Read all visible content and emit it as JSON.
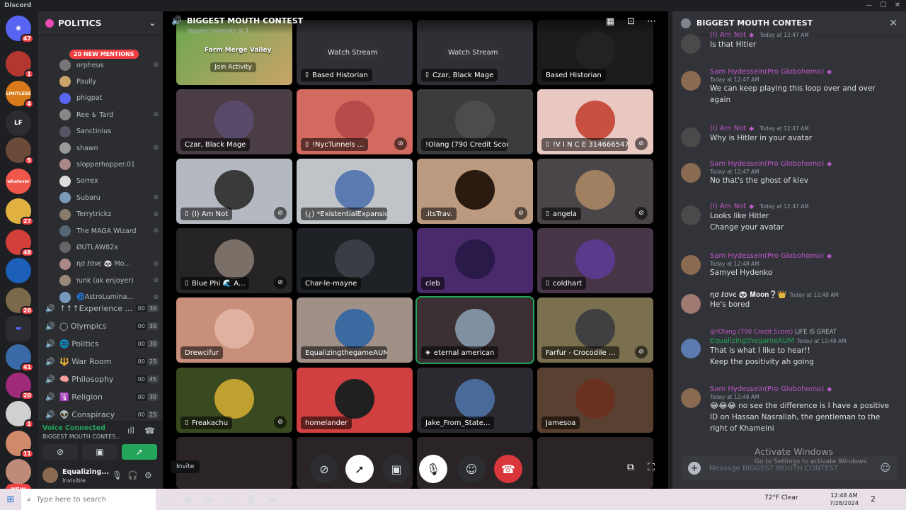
{
  "window": {
    "title": "Discord"
  },
  "servers": [
    {
      "label": "",
      "badge": "47",
      "color": "#5865f2",
      "icon": "discord-home-icon"
    },
    {
      "label": "",
      "badge": "1",
      "color": "#b3372f",
      "icon": "server-avatar-icon"
    },
    {
      "label": "LIMITLESS",
      "badge": "4",
      "color": "#d97a1a",
      "icon": "server-avatar-icon"
    },
    {
      "label": "LF",
      "badge": "",
      "color": "#2b2d31",
      "icon": "server-avatar-icon"
    },
    {
      "label": "",
      "badge": "5",
      "color": "#6b4a3a",
      "icon": "server-avatar-icon"
    },
    {
      "label": "whatever",
      "badge": "",
      "color": "#f0574b",
      "icon": "server-avatar-icon"
    },
    {
      "label": "",
      "badge": "27",
      "color": "#e0b040",
      "icon": "server-avatar-icon"
    },
    {
      "label": "",
      "badge": "48",
      "color": "#d43f3a",
      "icon": "server-avatar-icon"
    },
    {
      "label": "",
      "badge": "",
      "color": "#1b5fb8",
      "icon": "server-avatar-icon"
    },
    {
      "label": "",
      "badge": "26",
      "color": "#7a6a4a",
      "icon": "server-avatar-icon"
    },
    {
      "label": "",
      "badge": "",
      "color": "#5865f2",
      "icon": "folder-icon"
    },
    {
      "label": "",
      "badge": "41",
      "color": "#3a6aa8",
      "icon": "server-avatar-icon"
    },
    {
      "label": "",
      "badge": "20",
      "color": "#a02a7a",
      "icon": "server-avatar-icon"
    },
    {
      "label": "",
      "badge": "1",
      "color": "#d0d0d0",
      "icon": "server-avatar-icon"
    },
    {
      "label": "",
      "badge": "11",
      "color": "#d08a6a",
      "icon": "server-avatar-icon"
    },
    {
      "label": "",
      "badge": "",
      "color": "#c08a7a",
      "icon": "server-avatar-icon"
    }
  ],
  "new_label": "NEW",
  "sidebar": {
    "guild_name": "POLITICS",
    "mentions_label": "20 NEW MENTIONS",
    "members": [
      {
        "name": "orpheus",
        "color": "#777"
      },
      {
        "name": "Paully",
        "color": "#c9a36a"
      },
      {
        "name": "phigpat",
        "color": "#5865f2"
      },
      {
        "name": "Ree ♿ Tard",
        "color": "#888"
      },
      {
        "name": "Sanctinius",
        "color": "#556"
      },
      {
        "name": "shawn",
        "color": "#999"
      },
      {
        "name": "slopperhopper.01",
        "color": "#a88"
      },
      {
        "name": "Sorrex",
        "color": "#ddd"
      },
      {
        "name": "Subaru",
        "color": "#7a9ab8"
      },
      {
        "name": "Terrytrickz",
        "color": "#8a7a6a"
      },
      {
        "name": "The MAGA Wizard",
        "color": "#556677"
      },
      {
        "name": "ØUTLAW82x",
        "color": "#666"
      },
      {
        "name": "ɳσ ℓσνє 🐼 Mo...",
        "color": "#a88"
      },
      {
        "name": "𝔣unk (ak enjoyer)",
        "color": "#998877"
      },
      {
        "name": "🌀AstroLumina...",
        "color": "#7799bb"
      }
    ],
    "voice_channels": [
      {
        "name": "↑↑↑Experience ...",
        "a": "00",
        "b": "30",
        "icon": "🔊"
      },
      {
        "name": "◯ Olympics",
        "a": "00",
        "b": "30",
        "icon": "🔊"
      },
      {
        "name": "🌐 Politics",
        "a": "00",
        "b": "30",
        "icon": "🔊"
      },
      {
        "name": "🔱 War Room",
        "a": "00",
        "b": "25",
        "icon": "🔊"
      },
      {
        "name": "🧠 Philosophy",
        "a": "00",
        "b": "45",
        "icon": "🔊"
      },
      {
        "name": "🛐 Religion",
        "a": "00",
        "b": "30",
        "icon": "🔊"
      },
      {
        "name": "👽 Conspiracy",
        "a": "00",
        "b": "25",
        "icon": "🔊"
      }
    ],
    "voice_status": "Voice Connected",
    "voice_channel": "BIGGEST MOUTH CONTES...",
    "user_name": "Equalizing...",
    "user_status": "Invisible"
  },
  "stage": {
    "title": "BIGGEST MOUTH CONTEST",
    "subtitle": "Yappers University 😕 3",
    "activity": {
      "name": "Farm Merge Valley",
      "join": "Join Activity"
    },
    "watch_label": "Watch Stream",
    "tiles": [
      {
        "name": "Based Historian",
        "phone": true,
        "bg": "#2f3035",
        "watch": true
      },
      {
        "name": "Czar, Black Mage",
        "phone": true,
        "bg": "#2f3035",
        "watch": true
      },
      {
        "name": "Based Historian",
        "phone": false,
        "bg": "#1c1c1e",
        "pic": "#222"
      },
      {
        "name": "Czar, Black Mage",
        "phone": false,
        "bg": "#4a3d45",
        "pic": "#5a4a6a"
      },
      {
        "name": "!NycTunnels ...",
        "phone": true,
        "bg": "#d26a60",
        "pic": "#b84a4a",
        "mute": true
      },
      {
        "name": "!Olang (790 Credit Score)",
        "phone": false,
        "bg": "#3a3d3c",
        "pic": "#4a4d4c"
      },
      {
        "name": "!V I N C E 3146665477",
        "phone": true,
        "bg": "#e8c8c0",
        "pic": "#c85040",
        "mute": true
      },
      {
        "name": "(I) Am Not",
        "phone": true,
        "bg": "#b4b8c0",
        "pic": "#3a3a3a",
        "mute": true
      },
      {
        "name": "(¿) *ExistentialExpansio...",
        "phone": false,
        "bg": "#c0c4c8",
        "pic": "#5a7ab0"
      },
      {
        "name": ".itsTrav.",
        "phone": false,
        "bg": "#bc9a80",
        "pic": "#2a1a10",
        "mute": true
      },
      {
        "name": "angela",
        "phone": true,
        "bg": "#4a4548",
        "pic": "#a08060",
        "mute": true
      },
      {
        "name": "Blue Phi 🌊 A...",
        "phone": true,
        "bg": "#262424",
        "pic": "#7a7068",
        "mute": true
      },
      {
        "name": "Char-le-mayne",
        "phone": false,
        "bg": "#1e2226",
        "pic": "#3a3e44"
      },
      {
        "name": "cleb",
        "phone": false,
        "bg": "#4a2a6a",
        "pic": "#2a1a4a"
      },
      {
        "name": "coldhart",
        "phone": true,
        "bg": "#463648",
        "pic": "#5a3a8a"
      },
      {
        "name": "Drewcifur",
        "phone": false,
        "bg": "#c8907a",
        "pic": "#e0b0a0"
      },
      {
        "name": "EqualizingthegameAUM",
        "phone": false,
        "bg": "#a09088",
        "pic": "#3a6aa0"
      },
      {
        "name": "eternal american",
        "phone": false,
        "bg": "#3a3034",
        "pic": "#8090a0",
        "speaking": true,
        "ps": true
      },
      {
        "name": "Farfur - Crocodile ...",
        "phone": false,
        "bg": "#7a7050",
        "pic": "#404040",
        "mute": true
      },
      {
        "name": "Freakachu",
        "phone": true,
        "bg": "#3a4a20",
        "pic": "#c0a030",
        "mute": true
      },
      {
        "name": "homelander",
        "phone": false,
        "bg": "#d04040",
        "pic": "#202020"
      },
      {
        "name": "Jake_From_State...",
        "phone": false,
        "bg": "#2a2a30",
        "pic": "#4a6a9a"
      },
      {
        "name": "Jamesoa",
        "phone": false,
        "bg": "#5a4030",
        "pic": "#6a3020"
      }
    ]
  },
  "tooltip": {
    "invite": "Invite"
  },
  "chat": {
    "title": "BIGGEST MOUTH CONTEST",
    "placeholder": "Message BIGGEST MOUTH CONTEST",
    "messages": [
      {
        "author": "(I) Am Not",
        "gem": true,
        "time": "Today at 12:47 AM",
        "lines": [
          "Is that Hitler"
        ],
        "avc": "#4a4a4a",
        "inline": true
      },
      {
        "author": "Sam Hydessein(Pro Globohomo)",
        "gem": true,
        "time": "Today at 12:47 AM",
        "lines": [
          "We can keep playing this loop over and over again"
        ],
        "avc": "#8a6a50"
      },
      {
        "author": "(I) Am Not",
        "gem": true,
        "time": "Today at 12:47 AM",
        "lines": [
          "Why is Hitler in your avatar"
        ],
        "avc": "#4a4a4a",
        "inline": true
      },
      {
        "author": "Sam Hydessein(Pro Globohomo)",
        "gem": true,
        "time": "Today at 12:47 AM",
        "lines": [
          "No that's the ghost of kiev"
        ],
        "avc": "#8a6a50"
      },
      {
        "author": "(I) Am Not",
        "gem": true,
        "time": "Today at 12:47 AM",
        "lines": [
          "Looks like Hitler",
          "Change your avatar"
        ],
        "avc": "#4a4a4a",
        "inline": true
      },
      {
        "author": "Sam Hydessein(Pro Globohomo)",
        "gem": true,
        "time": "Today at 12:48 AM",
        "lines": [
          "Samyel Hydenko"
        ],
        "avc": "#8a6a50"
      },
      {
        "author": "ɳσ ℓσνє 🐼 𝐌𝐨𝐨𝐧❔👑",
        "gem": false,
        "time": "Today at 12:48 AM",
        "lines": [
          "He's bored"
        ],
        "avc": "#a07a70",
        "inline": true,
        "plain": true
      },
      {
        "author": "EqualizingthegameAUM",
        "gem": false,
        "time": "Today at 12:48 AM",
        "lines": [
          "That is what I like to hear!!",
          "Keep the positivity ah going"
        ],
        "avc": "#5a7ab0",
        "inline": true,
        "green": true,
        "reply_to": "@!Olang (790 Credit Score)",
        "reply_text": "LIFE IS GREAT"
      },
      {
        "author": "Sam Hydessein(Pro Globohomo)",
        "gem": true,
        "time": "Today at 12:48 AM",
        "lines": [
          "😂😂😂 no see the difference is I have a positive ID on Hassan Nasrallah, the gentleman to the right of Khameini"
        ],
        "avc": "#8a6a50"
      }
    ]
  },
  "watermark": {
    "line1": "Activate Windows",
    "line2": "Go to Settings to activate Windows."
  },
  "taskbar": {
    "search_placeholder": "Type here to search",
    "weather": "72°F  Clear",
    "time": "12:48 AM",
    "date": "7/28/2024",
    "notif_count": "2"
  }
}
